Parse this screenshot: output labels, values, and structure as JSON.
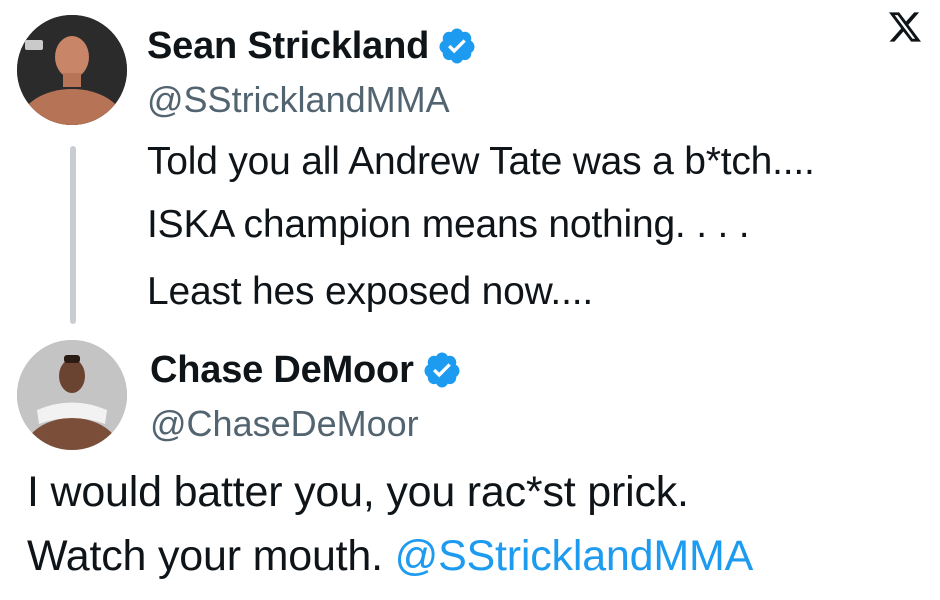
{
  "colors": {
    "text": "#0f1419",
    "secondary": "#536471",
    "link": "#1d9bf0",
    "verified": "#1d9bf0",
    "thread_line": "#c9cdd1"
  },
  "brand": {
    "icon": "x-logo-icon"
  },
  "original_post": {
    "avatar_icon": "avatar-image",
    "display_name": "Sean Strickland",
    "verified_icon": "verified-badge-icon",
    "handle": "@SStricklandMMA",
    "lines": [
      "Told you all Andrew Tate was a b*tch....",
      "ISKA champion means nothing. . . .",
      "Least hes exposed now...."
    ]
  },
  "reply_post": {
    "avatar_icon": "avatar-image",
    "display_name": "Chase DeMoor",
    "verified_icon": "verified-badge-icon",
    "handle": "@ChaseDeMoor",
    "line1": "I would batter you, you rac*st prick.",
    "line2_text": "Watch your mouth. ",
    "line2_mention": "@SStricklandMMA"
  }
}
